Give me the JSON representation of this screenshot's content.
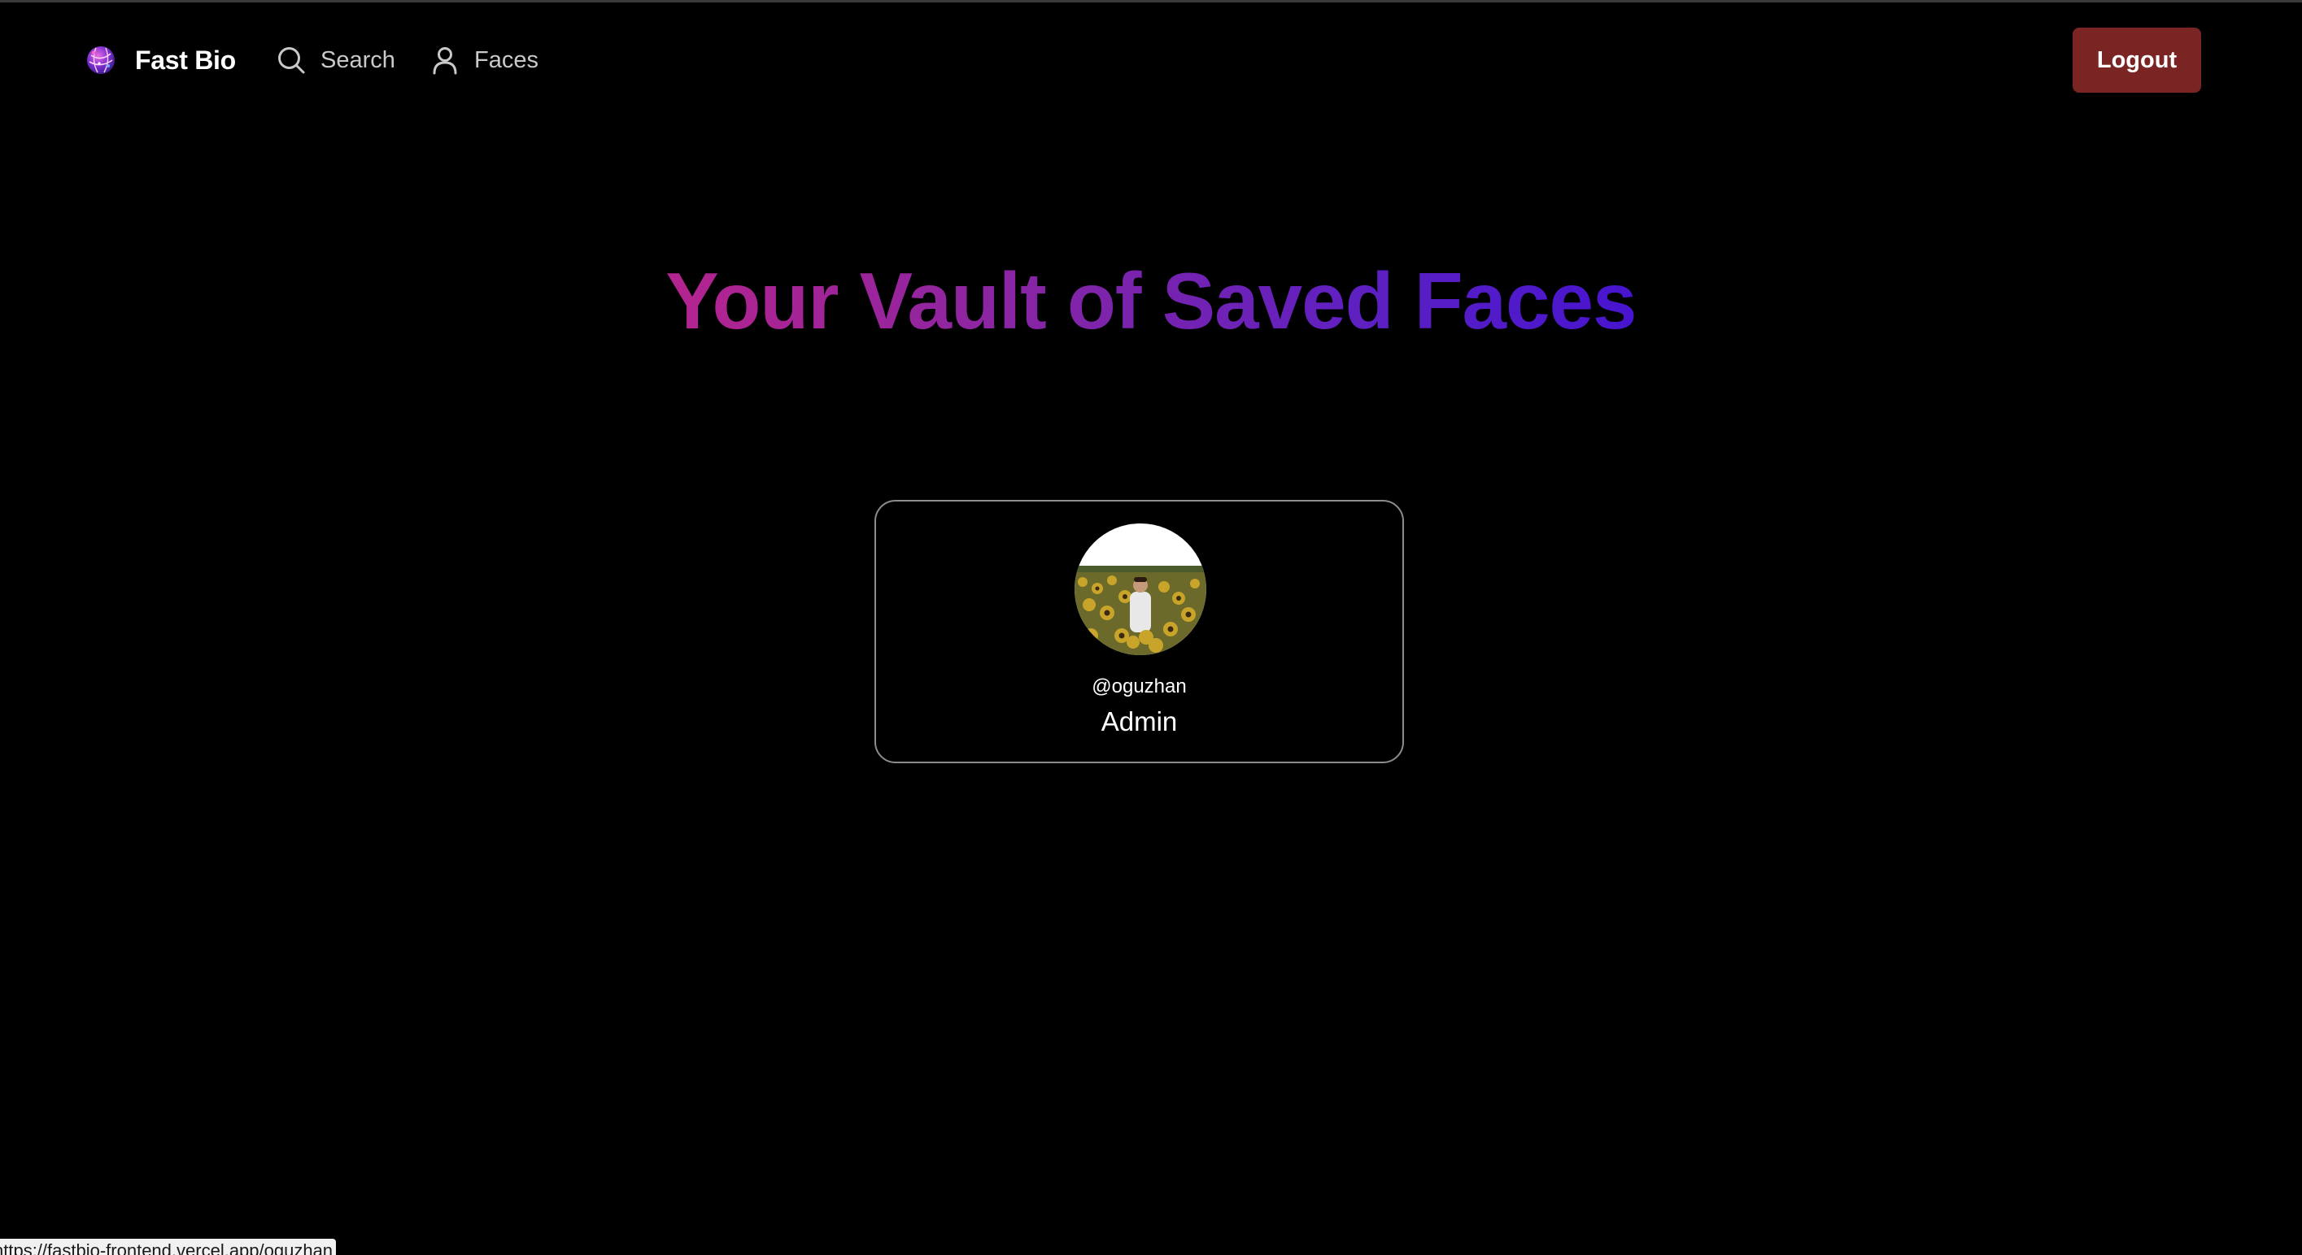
{
  "navbar": {
    "brand_name": "Fast Bio",
    "logo_icon": "globe-logo-icon",
    "links": [
      {
        "label": "Search",
        "icon": "search-icon"
      },
      {
        "label": "Faces",
        "icon": "user-icon"
      }
    ],
    "logout_label": "Logout"
  },
  "hero": {
    "title": "Your Vault of Saved Faces"
  },
  "faces": [
    {
      "username": "@oguzhan",
      "role": "Admin"
    }
  ],
  "status_bar": {
    "url": "https://fastbio-frontend.vercel.app/oguzhan"
  },
  "colors": {
    "background": "#000000",
    "logout_button": "#7a2424",
    "title_gradient_start": "#b5248f",
    "title_gradient_end": "#4714cf",
    "card_border": "#8c8c8c"
  }
}
